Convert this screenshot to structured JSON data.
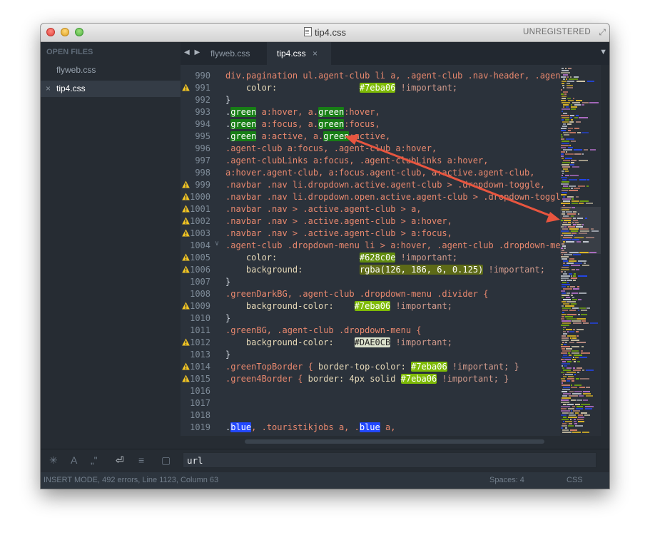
{
  "window": {
    "title": "tip4.css",
    "unregistered": "UNREGISTERED"
  },
  "sidebar": {
    "header": "OPEN FILES",
    "files": [
      {
        "name": "flyweb.css",
        "active": false
      },
      {
        "name": "tip4.css",
        "active": true,
        "close": "×"
      }
    ]
  },
  "tabbar": {
    "nav_arrows": "◀ ▶",
    "tabs": [
      {
        "label": "flyweb.css",
        "active": false
      },
      {
        "label": "tip4.css",
        "active": true,
        "close": "×"
      }
    ],
    "dropdown": "▼"
  },
  "editor": {
    "font": "monospace",
    "lines": [
      {
        "n": "990",
        "warn": false,
        "fold": "",
        "segs": [
          [
            "div.pagination ul.agent-club li a, .agent-club .nav-header, .agent-",
            "sel"
          ]
        ]
      },
      {
        "n": "991",
        "warn": true,
        "fold": "",
        "segs": [
          [
            "    ",
            ""
          ],
          [
            "color:",
            "prop"
          ],
          [
            "                ",
            ""
          ],
          [
            "#7eba06",
            "hl"
          ],
          [
            " !important;",
            "imp"
          ]
        ]
      },
      {
        "n": "992",
        "warn": false,
        "fold": "",
        "segs": [
          [
            "}",
            ""
          ]
        ]
      },
      {
        "n": "993",
        "warn": false,
        "fold": "",
        "segs": [
          [
            ".",
            ""
          ],
          [
            "green",
            "hg"
          ],
          [
            " a:hover, a.",
            "sel"
          ],
          [
            "green",
            "hg"
          ],
          [
            ":hover,",
            "sel"
          ]
        ]
      },
      {
        "n": "994",
        "warn": false,
        "fold": "",
        "segs": [
          [
            ".",
            ""
          ],
          [
            "green",
            "hg"
          ],
          [
            " a:focus, a.",
            "sel"
          ],
          [
            "green",
            "hg"
          ],
          [
            ":focus,",
            "sel"
          ]
        ]
      },
      {
        "n": "995",
        "warn": false,
        "fold": "",
        "segs": [
          [
            ".",
            ""
          ],
          [
            "green",
            "hg"
          ],
          [
            " a:active, a.",
            "sel"
          ],
          [
            "green",
            "hg"
          ],
          [
            ":active,",
            "sel"
          ]
        ]
      },
      {
        "n": "996",
        "warn": false,
        "fold": "",
        "segs": [
          [
            ".agent-club a:focus, .agent-club a:hover,",
            "sel"
          ]
        ]
      },
      {
        "n": "997",
        "warn": false,
        "fold": "",
        "segs": [
          [
            ".agent-clubLinks a:focus, .agent-clubLinks a:hover,",
            "sel"
          ]
        ]
      },
      {
        "n": "998",
        "warn": false,
        "fold": "",
        "segs": [
          [
            "a:hover.agent-club, a:focus.agent-club, a:active.agent-club,",
            "sel"
          ]
        ]
      },
      {
        "n": "999",
        "warn": true,
        "fold": "",
        "segs": [
          [
            ".navbar .nav li.dropdown.active.agent-club > .dropdown-toggle,",
            "sel"
          ]
        ]
      },
      {
        "n": "1000",
        "warn": true,
        "fold": "",
        "segs": [
          [
            ".navbar .nav li.dropdown.open.active.agent-club > .dropdown-toggle,",
            "sel"
          ]
        ]
      },
      {
        "n": "1001",
        "warn": true,
        "fold": "",
        "segs": [
          [
            ".navbar .nav > .active.agent-club > a,",
            "sel"
          ]
        ]
      },
      {
        "n": "1002",
        "warn": true,
        "fold": "",
        "segs": [
          [
            ".navbar .nav > .active.agent-club > a:hover,",
            "sel"
          ]
        ]
      },
      {
        "n": "1003",
        "warn": true,
        "fold": "",
        "segs": [
          [
            ".navbar .nav > .active.agent-club > a:focus,",
            "sel"
          ]
        ]
      },
      {
        "n": "1004",
        "warn": false,
        "fold": "∨",
        "segs": [
          [
            ".agent-club .dropdown-menu li > a:hover, .agent-club .dropdown-menu",
            "sel"
          ]
        ]
      },
      {
        "n": "1005",
        "warn": true,
        "fold": "",
        "segs": [
          [
            "    ",
            ""
          ],
          [
            "color:",
            "prop"
          ],
          [
            "                ",
            ""
          ],
          [
            "#628c0e",
            "hp"
          ],
          [
            " !important;",
            "imp"
          ]
        ]
      },
      {
        "n": "1006",
        "warn": true,
        "fold": "",
        "segs": [
          [
            "    ",
            ""
          ],
          [
            "background:",
            "prop"
          ],
          [
            "           ",
            ""
          ],
          [
            "rgba(126, 186, 6, 0.125)",
            "hr"
          ],
          [
            " !important;",
            "imp"
          ]
        ]
      },
      {
        "n": "1007",
        "warn": false,
        "fold": "",
        "segs": [
          [
            "}",
            ""
          ]
        ]
      },
      {
        "n": "1008",
        "warn": false,
        "fold": "",
        "segs": [
          [
            ".greenDarkBG, .agent-club .dropdown-menu .divider {",
            "sel"
          ]
        ]
      },
      {
        "n": "1009",
        "warn": true,
        "fold": "",
        "segs": [
          [
            "    ",
            ""
          ],
          [
            "background-color:",
            "prop"
          ],
          [
            "    ",
            ""
          ],
          [
            "#7eba06",
            "hl"
          ],
          [
            " !important;",
            "imp"
          ]
        ]
      },
      {
        "n": "1010",
        "warn": false,
        "fold": "",
        "segs": [
          [
            "}",
            ""
          ]
        ]
      },
      {
        "n": "1011",
        "warn": false,
        "fold": "",
        "segs": [
          [
            ".greenBG, .agent-club .dropdown-menu {",
            "sel"
          ]
        ]
      },
      {
        "n": "1012",
        "warn": true,
        "fold": "",
        "segs": [
          [
            "    ",
            ""
          ],
          [
            "background-color:",
            "prop"
          ],
          [
            "    ",
            ""
          ],
          [
            "#DAE0CB",
            "hd"
          ],
          [
            " !important;",
            "imp"
          ]
        ]
      },
      {
        "n": "1013",
        "warn": false,
        "fold": "",
        "segs": [
          [
            "}",
            ""
          ]
        ]
      },
      {
        "n": "1014",
        "warn": true,
        "fold": "",
        "segs": [
          [
            ".greenTopBorder { ",
            "sel"
          ],
          [
            "border-top-color: ",
            "prop"
          ],
          [
            "#7eba06",
            "hl"
          ],
          [
            " !important; }",
            "imp"
          ]
        ]
      },
      {
        "n": "1015",
        "warn": true,
        "fold": "",
        "segs": [
          [
            ".green4Border { ",
            "sel"
          ],
          [
            "border: 4px solid ",
            "prop"
          ],
          [
            "#7eba06",
            "hl"
          ],
          [
            " !important; }",
            "imp"
          ]
        ]
      },
      {
        "n": "1016",
        "warn": false,
        "fold": "",
        "segs": []
      },
      {
        "n": "1017",
        "warn": false,
        "fold": "",
        "segs": []
      },
      {
        "n": "1018",
        "warn": false,
        "fold": "",
        "segs": []
      },
      {
        "n": "1019",
        "warn": false,
        "fold": "",
        "segs": [
          [
            ".",
            ""
          ],
          [
            "blue",
            "hb"
          ],
          [
            ", .touristikjobs a, .",
            "sel"
          ],
          [
            "blue",
            "hb"
          ],
          [
            " a,",
            "sel"
          ]
        ]
      }
    ]
  },
  "findbar": {
    "icons": [
      "regex-icon",
      "case-icon",
      "whole-word-icon",
      "wrap-icon",
      "in-selection-icon",
      "highlight-icon"
    ],
    "glyphs": [
      "✳",
      "A",
      "„\"",
      "⏎",
      "≡",
      "▢"
    ],
    "value": "url"
  },
  "status": {
    "left": "INSERT MODE, 492 errors, Line 1123, Column 63",
    "spaces": "Spaces: 4",
    "syntax": "CSS"
  },
  "colors": {
    "background": "#2b323b",
    "sidebar": "#262c33",
    "selector": "#e8886e",
    "highlight_green": "#7eba06",
    "highlight_blue": "#2248ff",
    "warning": "#f3c623",
    "arrow": "#e8553f"
  }
}
